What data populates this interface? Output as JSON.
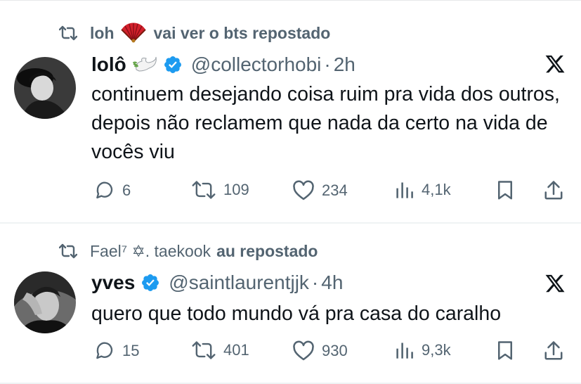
{
  "tweets": [
    {
      "repost_user": "loh",
      "repost_suffix": "vai ver o bts repostado",
      "name": "lolô",
      "handle": "@collectorhobi",
      "dot": "·",
      "time": "2h",
      "text": "continuem desejando coisa ruim pra vida dos outros, depois não reclamem que nada da certo na vida de vocês viu",
      "replies": "6",
      "reposts": "109",
      "likes": "234",
      "views": "4,1k"
    },
    {
      "repost_user": "Fael⁷ ✡. taekook",
      "repost_suffix": "au repostado",
      "name": "yves",
      "handle": "@saintlaurentjjk",
      "dot": "·",
      "time": "4h",
      "text": "quero que todo mundo vá pra casa do caralho",
      "replies": "15",
      "reposts": "401",
      "likes": "930",
      "views": "9,3k"
    }
  ],
  "icons": {
    "repost": "repost-icon",
    "verified": "verified-badge-icon",
    "platform": "x-logo-icon",
    "reply": "reply-icon",
    "like": "heart-icon",
    "views": "views-icon",
    "bookmark": "bookmark-icon",
    "share": "share-icon"
  },
  "colors": {
    "verified": "#1d9bf0",
    "muted": "#536471",
    "text": "#0f1419"
  }
}
